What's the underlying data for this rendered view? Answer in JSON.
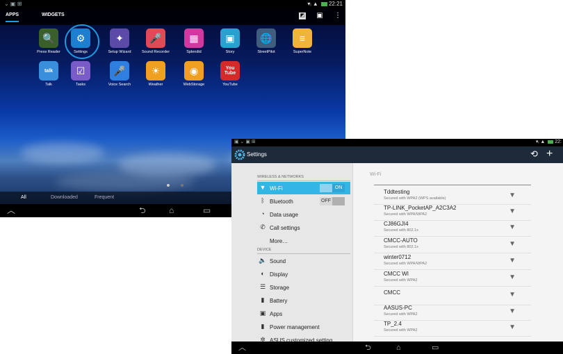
{
  "launcher": {
    "status_time": "22:21",
    "tabs": [
      "APPS",
      "WIDGETS"
    ],
    "apps_row1": [
      {
        "label": "Press Reader",
        "icon": "press-reader-icon",
        "glyph": "🔍",
        "color": "#3a5f2a"
      },
      {
        "label": "Settings",
        "icon": "settings-gear-icon",
        "glyph": "⚙",
        "color": "#1e7fd0"
      },
      {
        "label": "Setup Wizard",
        "icon": "setup-wizard-icon",
        "glyph": "✦",
        "color": "#5b4aa8"
      },
      {
        "label": "Sound Recorder",
        "icon": "microphone-icon",
        "glyph": "🎤",
        "color": "#e04a56"
      },
      {
        "label": "Splendid",
        "icon": "splendid-color-icon",
        "glyph": "▦",
        "color": "#d03aa0"
      },
      {
        "label": "Story",
        "icon": "story-photo-icon",
        "glyph": "▣",
        "color": "#2aa0d0"
      },
      {
        "label": "StreetPilot",
        "icon": "globe-map-icon",
        "glyph": "🌐",
        "color": "#3f5e7e"
      },
      {
        "label": "SuperNote",
        "icon": "notebook-icon",
        "glyph": "≡",
        "color": "#f0b43c"
      }
    ],
    "apps_row2": [
      {
        "label": "Talk",
        "icon": "talk-bubble-icon",
        "glyph": "talk",
        "color": "#3a8fdc"
      },
      {
        "label": "Tasks",
        "icon": "tasks-check-icon",
        "glyph": "☑",
        "color": "#7a5cc8"
      },
      {
        "label": "Voice Search",
        "icon": "voice-search-icon",
        "glyph": "🎤",
        "color": "#2f7fe0"
      },
      {
        "label": "Weather",
        "icon": "weather-sun-cloud-icon",
        "glyph": "☀",
        "color": "#f0a020"
      },
      {
        "label": "WebStorage",
        "icon": "webstorage-circle-icon",
        "glyph": "◉",
        "color": "#f0a020"
      },
      {
        "label": "YouTube",
        "icon": "youtube-icon",
        "glyph": "You Tube",
        "color": "#d42a2a"
      }
    ],
    "bottom_tabs": [
      "All",
      "Downloaded",
      "Frequent"
    ]
  },
  "settings": {
    "title": "Settings",
    "status_time": "22:",
    "section_wireless": "WIRELESS & NETWORKS",
    "section_device": "DEVICE",
    "items": [
      {
        "label": "Wi-Fi",
        "icon": "wifi-icon",
        "glyph": "▼",
        "toggle": "ON",
        "selected": true
      },
      {
        "label": "Bluetooth",
        "icon": "bluetooth-icon",
        "glyph": "ᛒ",
        "toggle": "OFF"
      },
      {
        "label": "Data usage",
        "icon": "data-usage-icon",
        "glyph": "◔"
      },
      {
        "label": "Call settings",
        "icon": "phone-icon",
        "glyph": "✆"
      },
      {
        "label": "More…",
        "icon": "",
        "glyph": ""
      },
      {
        "label": "Sound",
        "icon": "speaker-icon",
        "glyph": "🔈"
      },
      {
        "label": "Display",
        "icon": "display-brightness-icon",
        "glyph": "◐"
      },
      {
        "label": "Storage",
        "icon": "storage-icon",
        "glyph": "☰"
      },
      {
        "label": "Battery",
        "icon": "battery-icon",
        "glyph": "▮"
      },
      {
        "label": "Apps",
        "icon": "apps-icon",
        "glyph": "▣"
      },
      {
        "label": "Power management",
        "icon": "power-icon",
        "glyph": "▮"
      },
      {
        "label": "ASUS customized setting",
        "icon": "asus-gear-icon",
        "glyph": "✲"
      }
    ],
    "wifi_header": "Wi-Fi",
    "networks": [
      {
        "name": "Tddtesting",
        "security": "Secured with WPA2 (WPS available)"
      },
      {
        "name": "TP-LINK_PocketAP_A2C3A2",
        "security": "Secured with WPA/WPA2"
      },
      {
        "name": "CJ86GJI4",
        "security": "Secured with 802.1x"
      },
      {
        "name": "CMCC-AUTO",
        "security": "Secured with 802.1x"
      },
      {
        "name": "winter0712",
        "security": "Secured with WPA/WPA2"
      },
      {
        "name": "CMCC WI",
        "security": "Secured with WPA2"
      },
      {
        "name": "CMCC",
        "security": ""
      },
      {
        "name": "AASUS-PC",
        "security": "Secured with WPA2"
      },
      {
        "name": "TP_2.4",
        "security": "Secured with WPA2"
      }
    ]
  }
}
